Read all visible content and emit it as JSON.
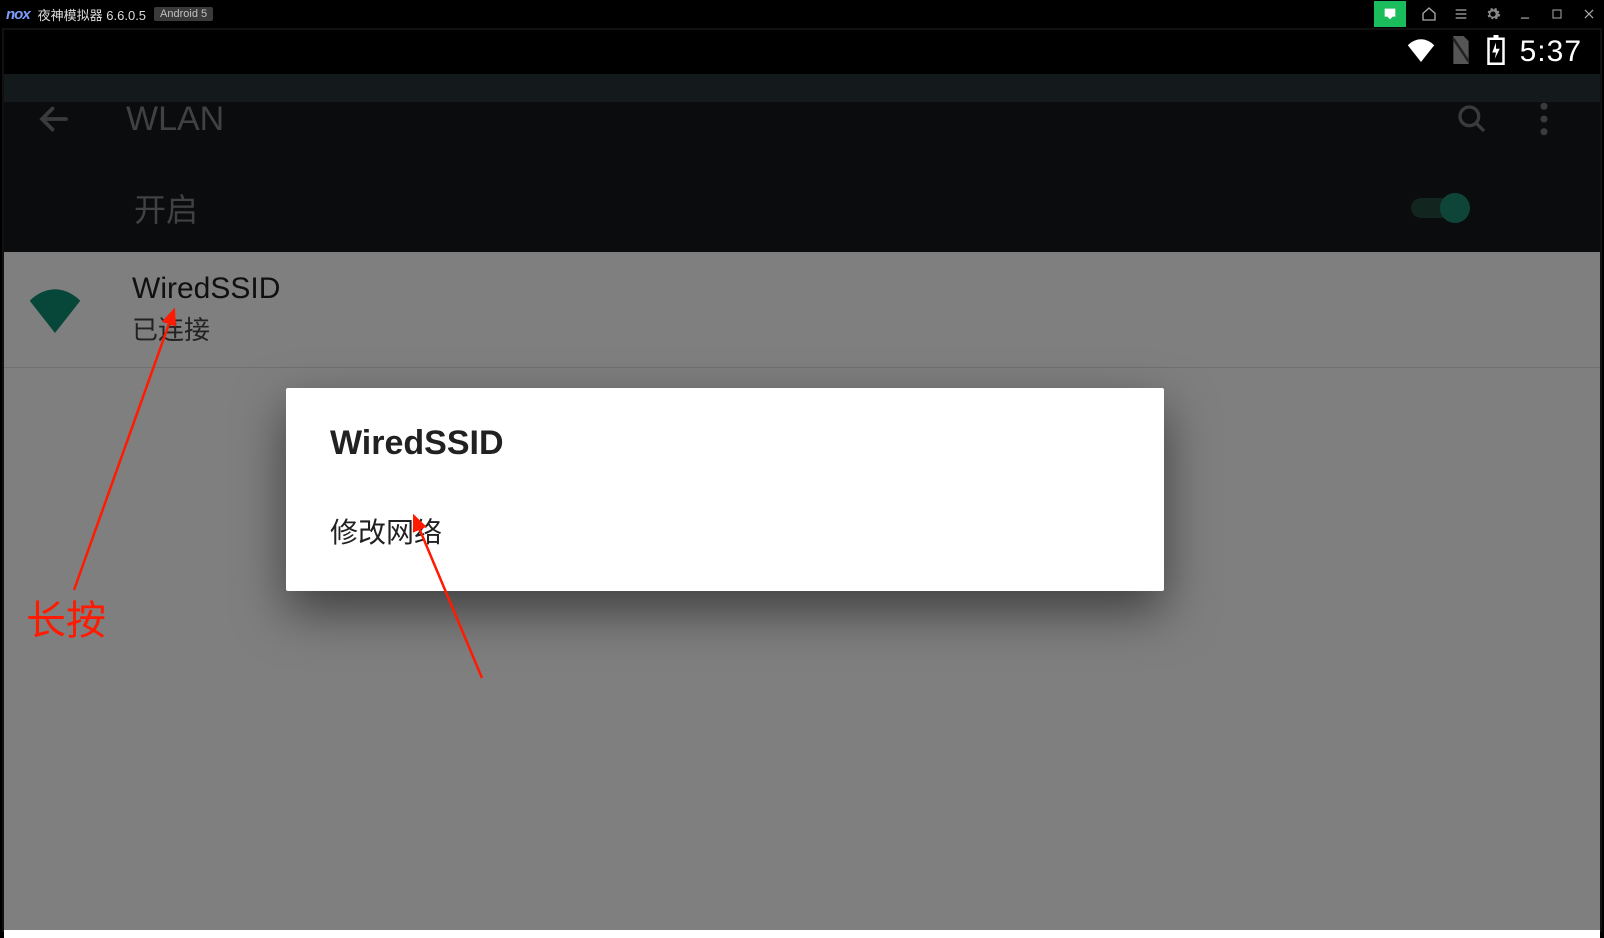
{
  "window": {
    "logo": "nox",
    "title": "夜神模拟器 6.6.0.5",
    "badge": "Android 5"
  },
  "statusbar": {
    "time": "5:37"
  },
  "appbar": {
    "title": "WLAN"
  },
  "wlan": {
    "enable_label": "开启",
    "network": {
      "ssid": "WiredSSID",
      "status": "已连接"
    }
  },
  "dialog": {
    "title": "WiredSSID",
    "item_modify": "修改网络"
  },
  "annotation": {
    "longpress": "长按"
  }
}
